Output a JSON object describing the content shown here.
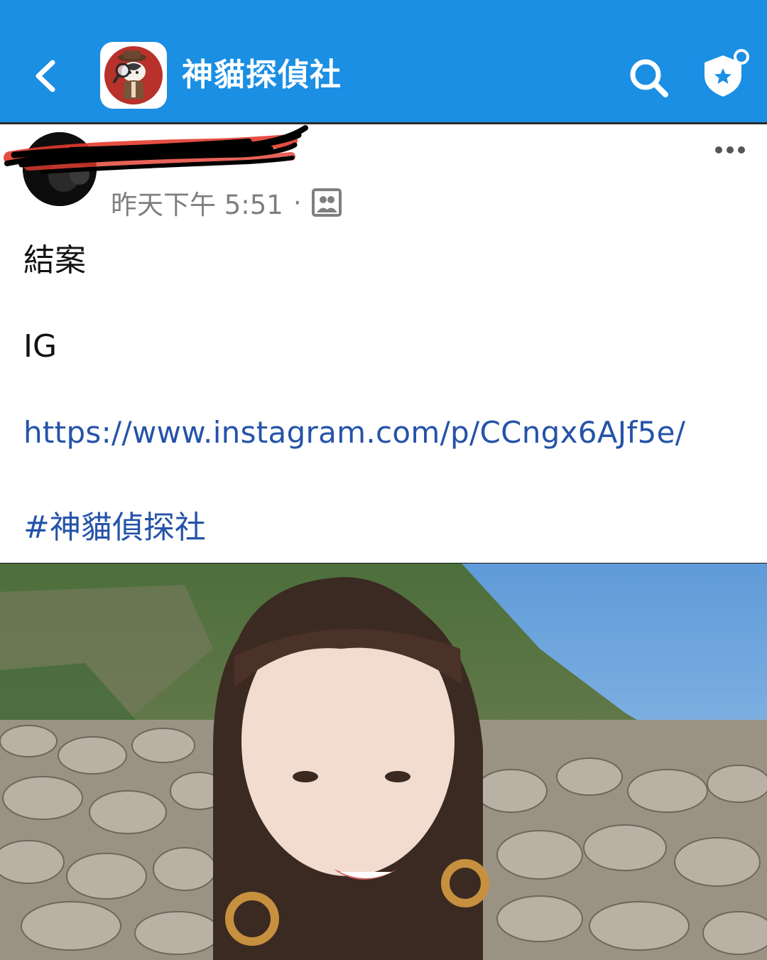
{
  "header": {
    "back_icon": "chevron-left-icon",
    "group_name": "神貓探偵社",
    "search_icon": "search-icon",
    "shield_icon": "shield-star-icon",
    "brand_color": "#1a8fe3"
  },
  "post": {
    "author_name_redacted": true,
    "timestamp": "昨天下午 5:51",
    "separator": "·",
    "audience_icon": "members-icon",
    "more_icon": "more-icon",
    "lines": [
      "結案",
      "IG"
    ],
    "link": "https://www.instagram.com/p/CCngx6AJf5e/",
    "hashtag": "#神貓偵探社",
    "link_color": "#2453a9"
  },
  "photo": {
    "description_icon": "photo"
  }
}
